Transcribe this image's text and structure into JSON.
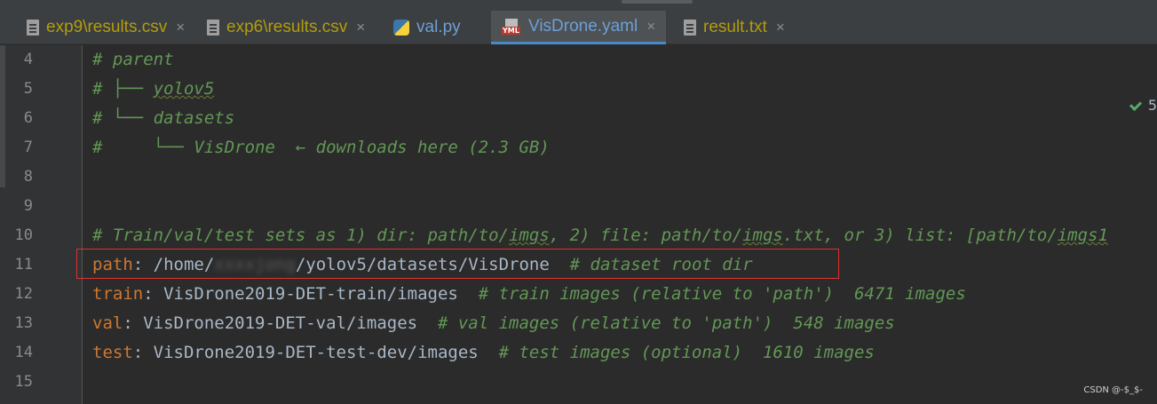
{
  "tabs": [
    {
      "label": "exp9\\results.csv",
      "icon": "text-file-icon",
      "close": "×"
    },
    {
      "label": "exp6\\results.csv",
      "icon": "text-file-icon",
      "close": "×"
    },
    {
      "label": "val.py",
      "icon": "python-file-icon",
      "close": ""
    },
    {
      "label": "VisDrone.yaml",
      "icon": "yaml-file-icon",
      "close": "×",
      "active": true
    },
    {
      "label": "result.txt",
      "icon": "text-file-icon",
      "close": "×"
    }
  ],
  "yaml_badge": "YML",
  "inspection": {
    "count": "5"
  },
  "lines": [
    {
      "num": "4",
      "comment": "# parent"
    },
    {
      "num": "5",
      "comment_prefix": "# ├── ",
      "comment_wavy": "yolov5"
    },
    {
      "num": "6",
      "comment": "# └── datasets"
    },
    {
      "num": "7",
      "comment": "#     └── VisDrone  ← downloads here (2.3 GB)"
    },
    {
      "num": "8"
    },
    {
      "num": "9"
    },
    {
      "num": "10",
      "comment_a": "# Train/val/test sets as 1) dir: path/to/",
      "comment_wavy_a": "imgs",
      "comment_b": ", 2) file: path/to/",
      "comment_wavy_b": "imgs",
      "comment_c": ".txt, or 3) list: [path/to/",
      "comment_wavy_c": "imgs1"
    },
    {
      "num": "11",
      "key": "path",
      "sep": ": ",
      "value_a": "/home/",
      "value_blur": "xxxxjong",
      "value_b": "/yolov5/datasets/VisDrone",
      "comment": "  # dataset root dir"
    },
    {
      "num": "12",
      "key": "train",
      "sep": ": ",
      "value": "VisDrone2019-DET-train/images",
      "comment": "  # train images (relative to 'path')  6471 images"
    },
    {
      "num": "13",
      "key": "val",
      "sep": ": ",
      "value": "VisDrone2019-DET-val/images",
      "comment": "  # val images (relative to 'path')  548 images"
    },
    {
      "num": "14",
      "key": "test",
      "sep": ": ",
      "value": "VisDrone2019-DET-test-dev/images",
      "comment": "  # test images (optional)  1610 images"
    },
    {
      "num": "15"
    }
  ],
  "watermark": "CSDN @-$_$-"
}
